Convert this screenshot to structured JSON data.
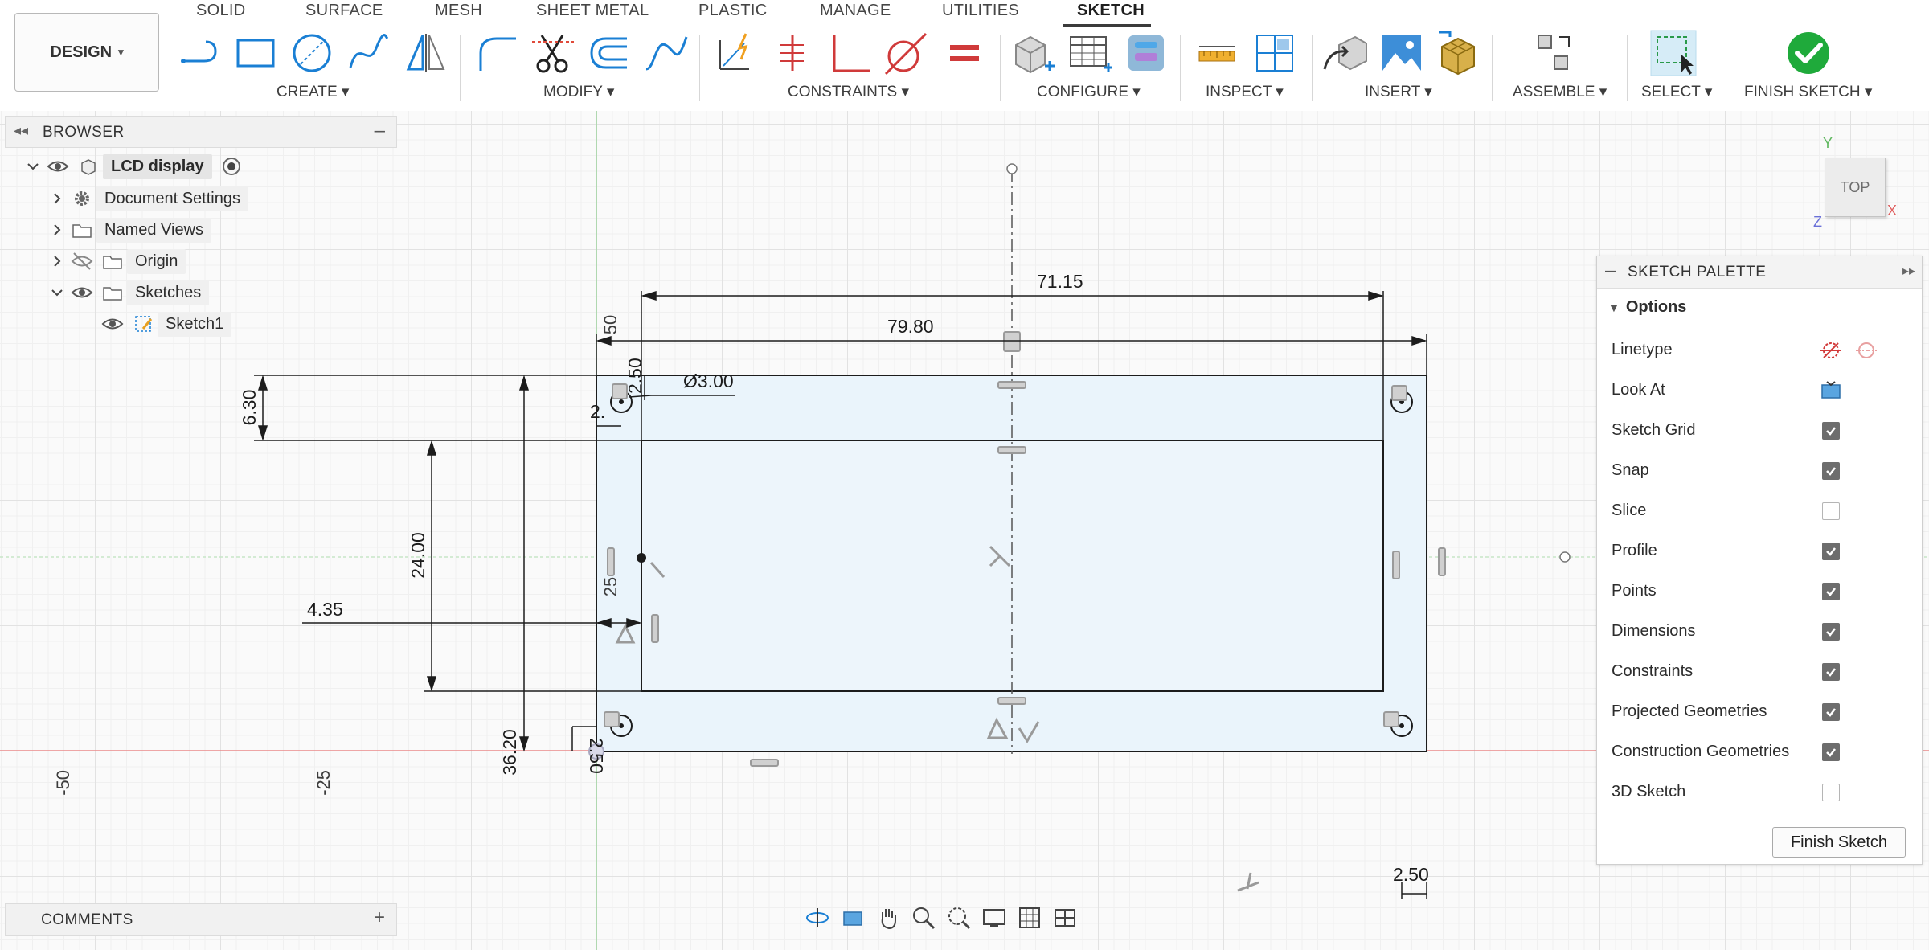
{
  "workspace": {
    "label": "DESIGN"
  },
  "tabs": [
    {
      "label": "SOLID",
      "active": false
    },
    {
      "label": "SURFACE",
      "active": false
    },
    {
      "label": "MESH",
      "active": false
    },
    {
      "label": "SHEET METAL",
      "active": false
    },
    {
      "label": "PLASTIC",
      "active": false
    },
    {
      "label": "MANAGE",
      "active": false
    },
    {
      "label": "UTILITIES",
      "active": false
    },
    {
      "label": "SKETCH",
      "active": true
    }
  ],
  "groups": {
    "create": "CREATE ▾",
    "modify": "MODIFY ▾",
    "constraints": "CONSTRAINTS ▾",
    "configure": "CONFIGURE ▾",
    "inspect": "INSPECT ▾",
    "insert": "INSERT ▾",
    "assemble": "ASSEMBLE ▾",
    "select": "SELECT ▾",
    "finish": "FINISH SKETCH ▾"
  },
  "browser": {
    "title": "BROWSER",
    "items": [
      {
        "label": "LCD display"
      },
      {
        "label": "Document Settings"
      },
      {
        "label": "Named Views"
      },
      {
        "label": "Origin"
      },
      {
        "label": "Sketches"
      },
      {
        "label": "Sketch1"
      }
    ]
  },
  "dimensions": {
    "outer_width": "79.80",
    "inner_width": "71.15",
    "top_offset": "6.30",
    "window_height": "24.00",
    "left_offset": "4.35",
    "total_height": "36.20",
    "hole_diameter": "Ø3.00",
    "hole_x": "2.50",
    "hole_y": "2.50",
    "hole_y_top": "2.50",
    "hole_x_top": "2.",
    "right_hole_x": "2.50"
  },
  "axis_labels": {
    "y50": "50",
    "y25": "25",
    "x_minus50": "-50",
    "x_minus25": "-25"
  },
  "viewcube": {
    "face": "TOP",
    "axis_y": "Y",
    "axis_x": "X",
    "axis_z": "Z"
  },
  "palette": {
    "title": "SKETCH PALETTE",
    "section": "Options",
    "options": [
      {
        "label": "Linetype",
        "type": "icons"
      },
      {
        "label": "Look At",
        "type": "icon"
      },
      {
        "label": "Sketch Grid",
        "checked": true
      },
      {
        "label": "Snap",
        "checked": true
      },
      {
        "label": "Slice",
        "checked": false
      },
      {
        "label": "Profile",
        "checked": true
      },
      {
        "label": "Points",
        "checked": true
      },
      {
        "label": "Dimensions",
        "checked": true
      },
      {
        "label": "Constraints",
        "checked": true
      },
      {
        "label": "Projected Geometries",
        "checked": true
      },
      {
        "label": "Construction Geometries",
        "checked": true
      },
      {
        "label": "3D Sketch",
        "checked": false
      }
    ],
    "finish_button": "Finish Sketch"
  },
  "comments": {
    "title": "COMMENTS"
  },
  "colors": {
    "accent": "#0a84d0",
    "finish_green": "#1faa3b",
    "profile_fill": "#eaf4fb",
    "x_axis": "#e98a8a",
    "y_axis": "#9fd49f"
  }
}
